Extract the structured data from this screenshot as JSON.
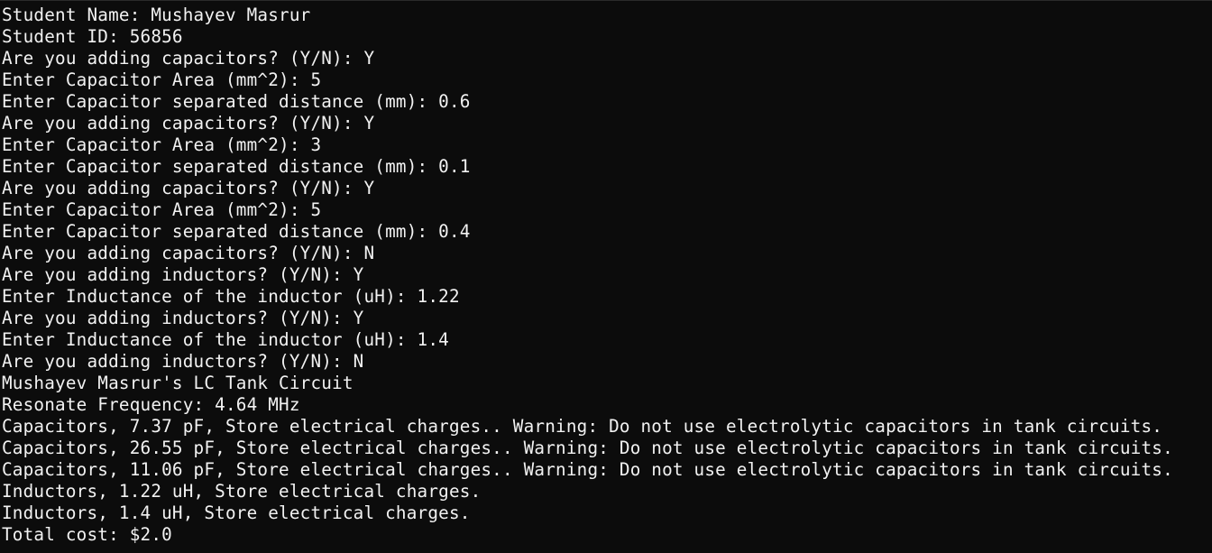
{
  "terminal": {
    "lines": [
      "Student Name: Mushayev Masrur",
      "Student ID: 56856",
      "Are you adding capacitors? (Y/N): Y",
      "Enter Capacitor Area (mm^2): 5",
      "Enter Capacitor separated distance (mm): 0.6",
      "Are you adding capacitors? (Y/N): Y",
      "Enter Capacitor Area (mm^2): 3",
      "Enter Capacitor separated distance (mm): 0.1",
      "Are you adding capacitors? (Y/N): Y",
      "Enter Capacitor Area (mm^2): 5",
      "Enter Capacitor separated distance (mm): 0.4",
      "Are you adding capacitors? (Y/N): N",
      "Are you adding inductors? (Y/N): Y",
      "Enter Inductance of the inductor (uH): 1.22",
      "Are you adding inductors? (Y/N): Y",
      "Enter Inductance of the inductor (uH): 1.4",
      "Are you adding inductors? (Y/N): N",
      "Mushayev Masrur's LC Tank Circuit",
      "Resonate Frequency: 4.64 MHz",
      "Capacitors, 7.37 pF, Store electrical charges.. Warning: Do not use electrolytic capacitors in tank circuits.",
      "Capacitors, 26.55 pF, Store electrical charges.. Warning: Do not use electrolytic capacitors in tank circuits.",
      "Capacitors, 11.06 pF, Store electrical charges.. Warning: Do not use electrolytic capacitors in tank circuits.",
      "Inductors, 1.22 uH, Store electrical charges.",
      "Inductors, 1.4 uH, Store electrical charges.",
      "Total cost: $2.0"
    ]
  },
  "colors": {
    "background": "#0c0c0c",
    "text": "#f2f2f2"
  }
}
